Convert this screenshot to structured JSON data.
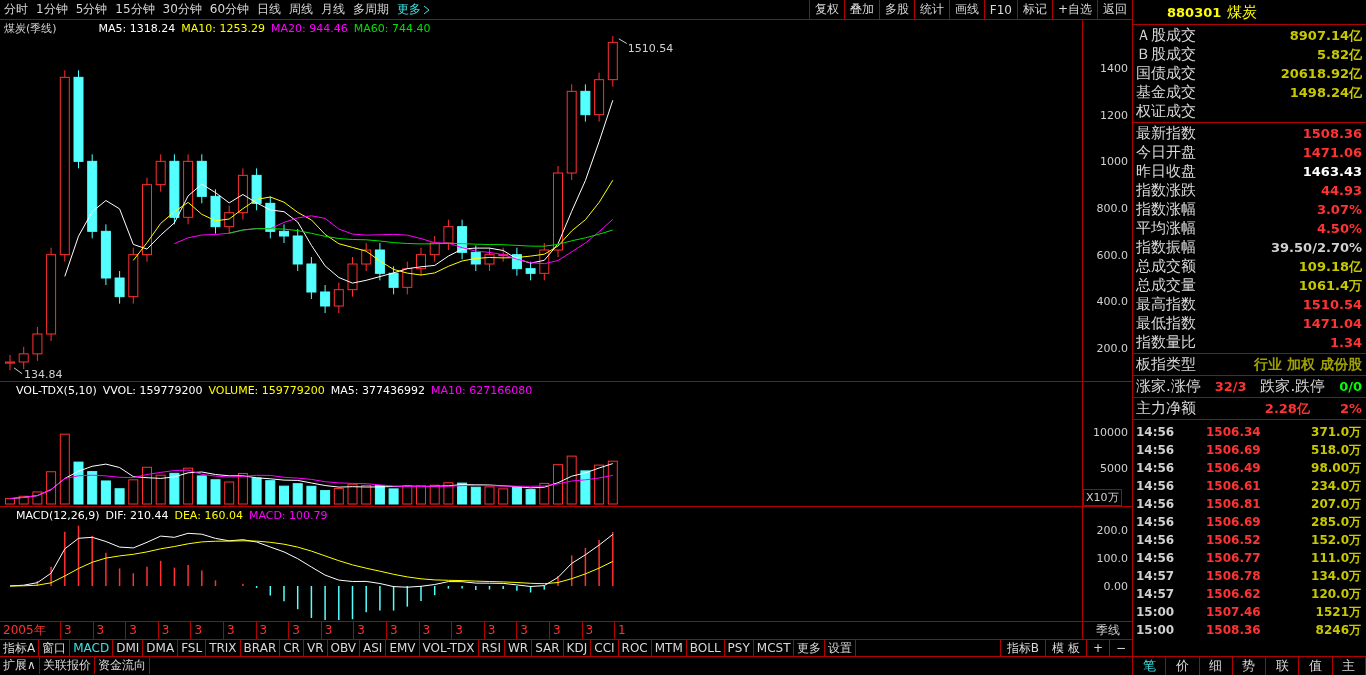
{
  "toolbar": {
    "periods": [
      "分时",
      "1分钟",
      "5分钟",
      "15分钟",
      "30分钟",
      "60分钟",
      "日线",
      "周线",
      "月线",
      "多周期"
    ],
    "more": "更多",
    "actions": [
      "复权",
      "叠加",
      "多股",
      "统计",
      "画线",
      "F10",
      "标记",
      "+自选",
      "返回"
    ]
  },
  "price_panel": {
    "title": "煤炭(季线)",
    "ma": [
      {
        "label": "MA5: 1318.24",
        "color": "#ffffff"
      },
      {
        "label": "MA10: 1253.29",
        "color": "#ffff00"
      },
      {
        "label": "MA20: 944.46",
        "color": "#ff00ff"
      },
      {
        "label": "MA60: 744.40",
        "color": "#00e000"
      }
    ],
    "yticks": [
      "1400",
      "1200",
      "1000",
      "800.0",
      "600.0",
      "400.0",
      "200.0"
    ],
    "high_label": "1510.54",
    "low_label": "134.84"
  },
  "volume_panel": {
    "legend": [
      {
        "label": "VOL-TDX(5,10)",
        "color": "#ffffff"
      },
      {
        "label": "VVOL: 159779200",
        "color": "#ffffff"
      },
      {
        "label": "VOLUME: 159779200",
        "color": "#ffff00"
      },
      {
        "label": "MA5: 377436992",
        "color": "#ffffff"
      },
      {
        "label": "MA10: 627166080",
        "color": "#ff00ff"
      }
    ],
    "yticks": [
      "10000",
      "5000"
    ],
    "unit": "X10万"
  },
  "macd_panel": {
    "legend": [
      {
        "label": "MACD(12,26,9)",
        "color": "#ffffff"
      },
      {
        "label": "DIF: 210.44",
        "color": "#ffffff"
      },
      {
        "label": "DEA: 160.04",
        "color": "#ffff00"
      },
      {
        "label": "MACD: 100.79",
        "color": "#ff00ff"
      }
    ],
    "yticks": [
      "200.0",
      "100.0",
      "0.00"
    ]
  },
  "date_axis": {
    "labels": [
      "2005年",
      "3",
      "3",
      "3",
      "3",
      "3",
      "3",
      "3",
      "3",
      "3",
      "3",
      "3",
      "3",
      "3",
      "3",
      "3",
      "3",
      "3",
      "1"
    ],
    "period": "季线"
  },
  "indicator_tabs": [
    {
      "label": "指标A",
      "selected": false
    },
    {
      "label": "窗口",
      "selected": false
    },
    {
      "label": "MACD",
      "selected": true
    },
    {
      "label": "DMI",
      "selected": false
    },
    {
      "label": "DMA",
      "selected": false
    },
    {
      "label": "FSL",
      "selected": false
    },
    {
      "label": "TRIX",
      "selected": false
    },
    {
      "label": "BRAR",
      "selected": false
    },
    {
      "label": "CR",
      "selected": false
    },
    {
      "label": "VR",
      "selected": false
    },
    {
      "label": "OBV",
      "selected": false
    },
    {
      "label": "ASI",
      "selected": false
    },
    {
      "label": "EMV",
      "selected": false
    },
    {
      "label": "VOL-TDX",
      "selected": false
    },
    {
      "label": "RSI",
      "selected": false
    },
    {
      "label": "WR",
      "selected": false
    },
    {
      "label": "SAR",
      "selected": false
    },
    {
      "label": "KDJ",
      "selected": false
    },
    {
      "label": "CCI",
      "selected": false
    },
    {
      "label": "ROC",
      "selected": false
    },
    {
      "label": "MTM",
      "selected": false
    },
    {
      "label": "BOLL",
      "selected": false
    },
    {
      "label": "PSY",
      "selected": false
    },
    {
      "label": "MCST",
      "selected": false
    },
    {
      "label": "更多",
      "selected": false
    },
    {
      "label": "设置",
      "selected": false
    }
  ],
  "indicator_right": [
    "指标B",
    "模 板",
    "+",
    "−"
  ],
  "bottom_tabs": [
    "扩展∧",
    "关联报价",
    "资金流向"
  ],
  "quote": {
    "code": "880301",
    "name": "煤炭",
    "sections": [
      [
        {
          "label": "Ａ股成交",
          "value": "8907.14亿",
          "color": "#c8c800"
        },
        {
          "label": "Ｂ股成交",
          "value": "5.82亿",
          "color": "#c8c800"
        },
        {
          "label": "国债成交",
          "value": "20618.92亿",
          "color": "#c8c800"
        },
        {
          "label": "基金成交",
          "value": "1498.24亿",
          "color": "#c8c800"
        },
        {
          "label": "权证成交"
        }
      ],
      [
        {
          "label": "最新指数",
          "value": "1508.36",
          "color": "#ff3333"
        },
        {
          "label": "今日开盘",
          "value": "1471.06",
          "color": "#ff3333"
        },
        {
          "label": "昨日收盘",
          "value": "1463.43",
          "color": "#ffffff"
        },
        {
          "label": "指数涨跌",
          "value": "44.93",
          "color": "#ff3333"
        },
        {
          "label": "指数涨幅",
          "value": "3.07%",
          "color": "#ff3333"
        },
        {
          "label": "平均涨幅",
          "value": "4.50%",
          "color": "#ff3333"
        },
        {
          "label": "指数振幅",
          "value": "39.50/2.70%",
          "color": "#d0d0d0"
        },
        {
          "label": "总成交额",
          "value": "109.18亿",
          "color": "#c8c800"
        },
        {
          "label": "总成交量",
          "value": "1061.4万",
          "color": "#c8c800"
        },
        {
          "label": "最高指数",
          "value": "1510.54",
          "color": "#ff3333"
        },
        {
          "label": "最低指数",
          "value": "1471.04",
          "color": "#ff3333"
        },
        {
          "label": "指数量比",
          "value": "1.34",
          "color": "#ff3333"
        }
      ],
      [
        {
          "label": "板指类型",
          "value": "行业 加权 成份股",
          "color": "#a0a000"
        }
      ]
    ],
    "breadth": {
      "up_label": "涨家.涨停",
      "up_value": "32/3",
      "down_label": "跌家.跌停",
      "down_value": "0/0"
    },
    "flow": {
      "label": "主力净额",
      "value": "2.28亿",
      "percent": "2%"
    }
  },
  "ticks": [
    {
      "time": "14:56",
      "price": "1506.34",
      "volume": "371.0万"
    },
    {
      "time": "14:56",
      "price": "1506.69",
      "volume": "518.0万"
    },
    {
      "time": "14:56",
      "price": "1506.49",
      "volume": "98.00万"
    },
    {
      "time": "14:56",
      "price": "1506.61",
      "volume": "234.0万"
    },
    {
      "time": "14:56",
      "price": "1506.81",
      "volume": "207.0万"
    },
    {
      "time": "14:56",
      "price": "1506.69",
      "volume": "285.0万"
    },
    {
      "time": "14:56",
      "price": "1506.52",
      "volume": "152.0万"
    },
    {
      "time": "14:56",
      "price": "1506.77",
      "volume": "111.0万"
    },
    {
      "time": "14:57",
      "price": "1506.78",
      "volume": "134.0万"
    },
    {
      "time": "14:57",
      "price": "1506.62",
      "volume": "120.0万"
    },
    {
      "time": "15:00",
      "price": "1507.46",
      "volume": "1521万"
    },
    {
      "time": "15:00",
      "price": "1508.36",
      "volume": "8246万"
    }
  ],
  "side_tabs": [
    {
      "label": "笔",
      "selected": true
    },
    {
      "label": "价",
      "selected": false
    },
    {
      "label": "细",
      "selected": false
    },
    {
      "label": "势",
      "selected": false
    },
    {
      "label": "联",
      "selected": false
    },
    {
      "label": "值",
      "selected": false
    },
    {
      "label": "主",
      "selected": false
    }
  ]
}
